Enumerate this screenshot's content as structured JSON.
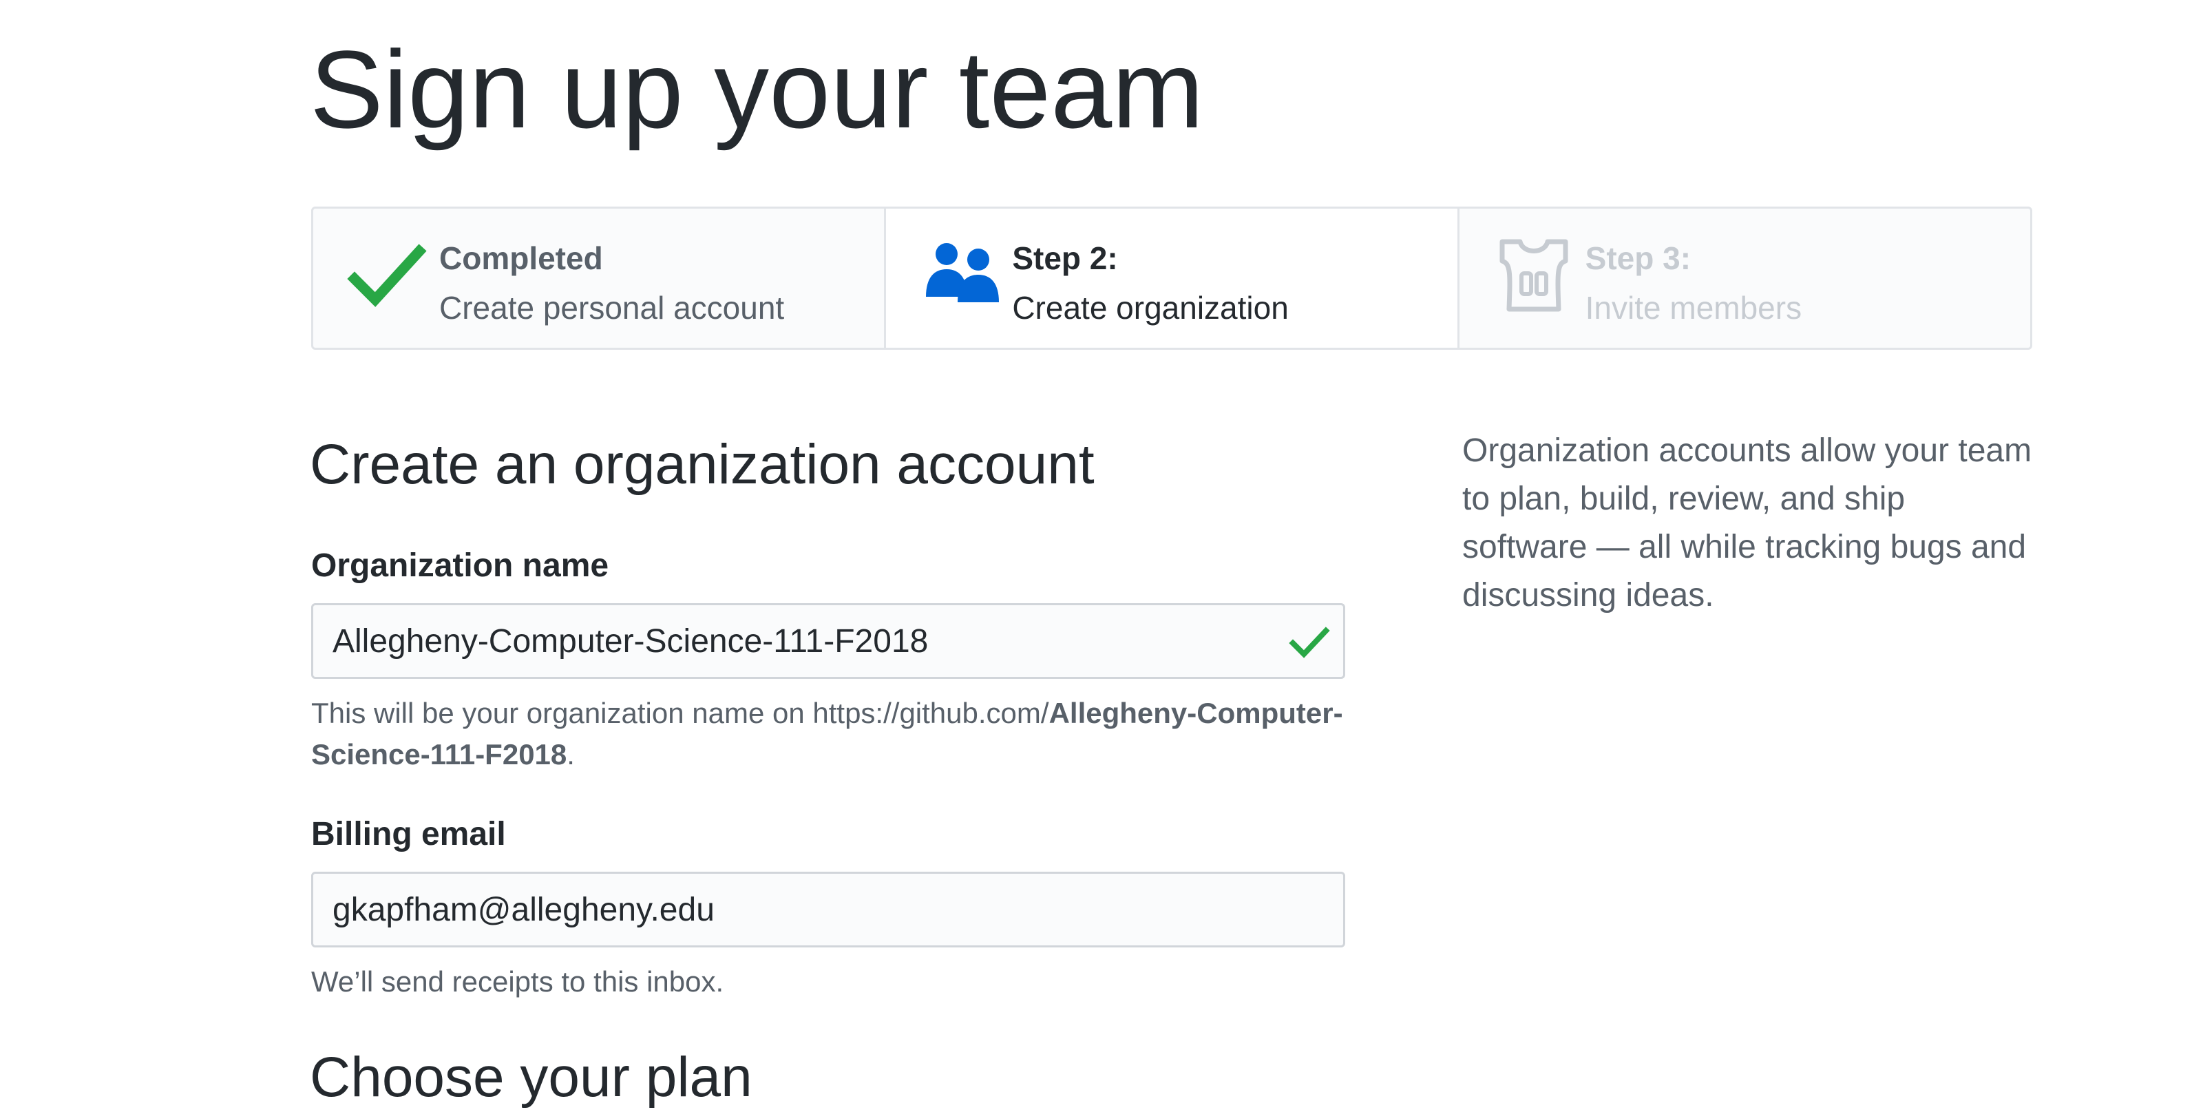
{
  "page": {
    "title": "Sign up your team"
  },
  "steps": [
    {
      "state": "completed",
      "icon": "checkmark-icon",
      "heading": "Completed",
      "description": "Create personal account"
    },
    {
      "state": "current",
      "icon": "people-icon",
      "heading": "Step 2:",
      "description": "Create organization"
    },
    {
      "state": "pending",
      "icon": "jersey-icon",
      "heading": "Step 3:",
      "description": "Invite members"
    }
  ],
  "form": {
    "section_title": "Create an organization account",
    "org_name": {
      "label": "Organization name",
      "value": "Allegheny-Computer-Science-111-F2018",
      "valid": true,
      "hint_prefix": "This will be your organization name on https://github.com/",
      "hint_org": "Allegheny-Computer-Science-111-F2018",
      "hint_suffix": "."
    },
    "billing_email": {
      "label": "Billing email",
      "value": "gkapfham@allegheny.edu",
      "hint": "We’ll send receipts to this inbox."
    },
    "plan_title": "Choose your plan"
  },
  "sidebar": {
    "text": "Organization accounts allow your team to plan, build, review, and ship software — all while tracking bugs and discussing ideas."
  },
  "colors": {
    "success": "#28a745",
    "accent_blue": "#0366d6",
    "muted": "#586069",
    "disabled": "#c6cbd1"
  }
}
